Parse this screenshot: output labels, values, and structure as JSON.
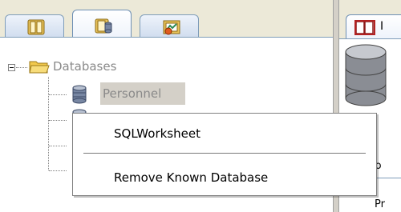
{
  "tree": {
    "root_label": "Databases",
    "items": [
      {
        "label": "Personnel",
        "selected": true
      },
      {
        "label": ""
      },
      {
        "label": ""
      }
    ]
  },
  "right_pane": {
    "tab_label": "I",
    "info_label": "Info",
    "pr_label": "Pr"
  },
  "context_menu": {
    "items": [
      {
        "label": "SQLWorksheet"
      },
      {
        "label": "Remove Known Database"
      }
    ]
  },
  "icons": {
    "tab1": "table-book-icon",
    "tab2": "database-book-icon",
    "tab3": "chart-image-icon",
    "root": "folder-open-icon",
    "db": "database-icon",
    "right_tab": "book-icon"
  },
  "colors": {
    "tree_text": "#8a8a8a",
    "tab_border": "#7f9db9",
    "selection": "#d4d0c8"
  }
}
